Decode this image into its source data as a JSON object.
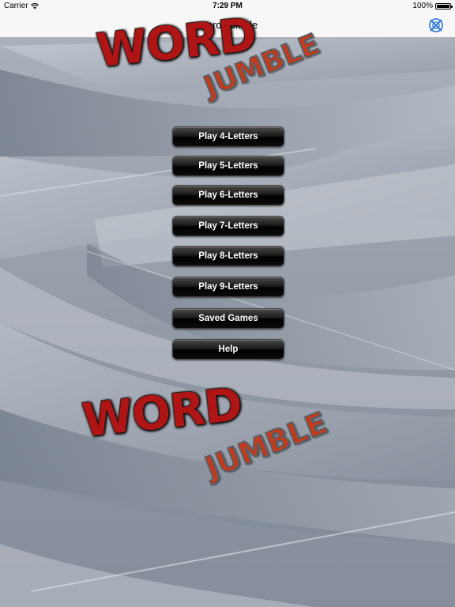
{
  "status_bar": {
    "carrier": "Carrier",
    "time": "7:29 PM",
    "battery": "100%"
  },
  "nav": {
    "title": "Word Jumble",
    "action_icon": "game-center-icon"
  },
  "logo_top": {
    "word": "WORD",
    "jumble": "JUMBLE"
  },
  "logo_bottom": {
    "word": "WORD",
    "jumble": "JUMBLE"
  },
  "menu": [
    {
      "label": "Play 4-Letters"
    },
    {
      "label": "Play 5-Letters"
    },
    {
      "label": "Play 6-Letters"
    },
    {
      "label": "Play 7-Letters"
    },
    {
      "label": "Play 8-Letters"
    },
    {
      "label": "Play 9-Letters"
    },
    {
      "label": "Saved Games"
    },
    {
      "label": "Help"
    }
  ],
  "colors": {
    "background": "#9aa2ad",
    "button": "#000000",
    "logo_red": "#b01515",
    "nav_accent": "#1e6fd8"
  }
}
